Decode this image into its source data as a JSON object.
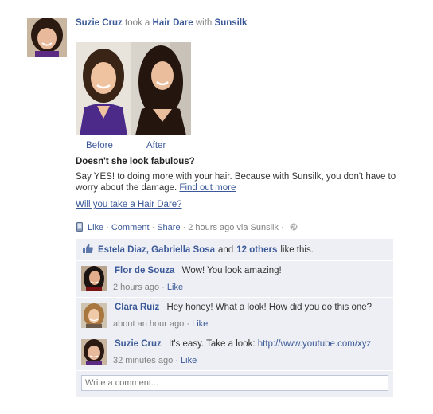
{
  "story": {
    "author": "Suzie Cruz",
    "verb": "took a",
    "object": "Hair Dare",
    "preposition": "with",
    "app": "Sunsilk"
  },
  "photos": {
    "before_label": "Before",
    "after_label": "After"
  },
  "attachment": {
    "title": "Doesn't she look fabulous?",
    "body": "Say YES! to doing more with your hair. Because with Sunsilk, you don't have to worry about the damage.",
    "link": "Find out more",
    "question": "Will you take a Hair Dare?"
  },
  "actions": {
    "like": "Like",
    "comment": "Comment",
    "share": "Share",
    "timestamp": "2 hours ago via Sunsilk",
    "icons": {
      "device": "mobile-phone-icon",
      "privacy": "globe-icon"
    }
  },
  "likes": {
    "names": "Estela Diaz, Gabriella Sosa",
    "and": "and",
    "others": "12 others",
    "suffix": "like this."
  },
  "comments": [
    {
      "author": "Flor de Souza",
      "text": "Wow! You look amazing!",
      "time": "2 hours ago",
      "like": "Like"
    },
    {
      "author": "Clara Ruiz",
      "text": "Hey honey! What a look! How did you do this one?",
      "time": "about an hour ago",
      "like": "Like"
    },
    {
      "author": "Suzie Cruz",
      "text": "It's easy. Take a look:",
      "link": "http://www.youtube.com/xyz",
      "time": "32 minutes ago",
      "like": "Like"
    }
  ],
  "composer": {
    "placeholder": "Write a comment..."
  },
  "colors": {
    "link": "#3b5998",
    "ufi_bg": "#edeff4",
    "muted": "#808080"
  }
}
